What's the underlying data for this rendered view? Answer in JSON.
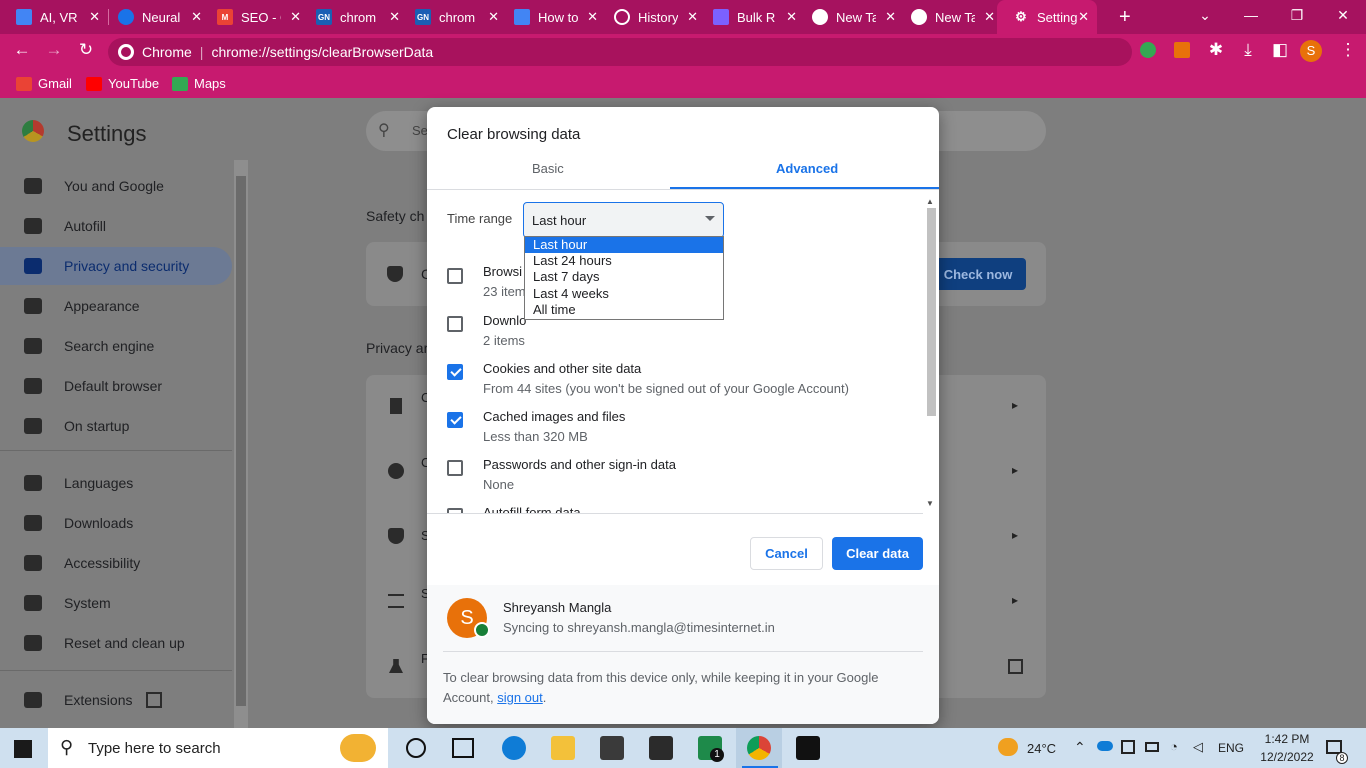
{
  "browser": {
    "tabs": [
      {
        "title": "AI, VR",
        "icon": "docs-icon",
        "color": "#4285f4"
      },
      {
        "title": "Neural",
        "icon": "neural-icon",
        "color": "#1a73e8"
      },
      {
        "title": "SEO - G",
        "icon": "gmail-icon",
        "color": "#ea4335"
      },
      {
        "title": "chrom",
        "icon": "gn-icon",
        "color": "#1a5fb4"
      },
      {
        "title": "chrom",
        "icon": "gn-icon",
        "color": "#1a5fb4"
      },
      {
        "title": "How to",
        "icon": "docs-icon",
        "color": "#4285f4"
      },
      {
        "title": "History",
        "icon": "history-icon",
        "color": "#5f6368"
      },
      {
        "title": "Bulk R",
        "icon": "bulk-icon",
        "color": "#7b61ff"
      },
      {
        "title": "New Ta",
        "icon": "chrome-icon",
        "color": "#5f6368"
      },
      {
        "title": "New Ta",
        "icon": "chrome-icon",
        "color": "#5f6368"
      },
      {
        "title": "Setting",
        "icon": "gear-icon",
        "color": "#5f6368"
      }
    ],
    "new_tab": "+",
    "address": {
      "site_label": "Chrome",
      "url": "chrome://settings/clearBrowserData"
    },
    "profile_initial": "S",
    "bookmarks": [
      {
        "label": "Gmail",
        "icon": "gmail-icon",
        "color": "#ea4335"
      },
      {
        "label": "YouTube",
        "icon": "youtube-icon",
        "color": "#ff0000"
      },
      {
        "label": "Maps",
        "icon": "maps-icon",
        "color": "#34a853"
      }
    ]
  },
  "settings": {
    "title": "Settings",
    "search_placeholder": "Se",
    "nav": [
      {
        "label": "You and Google",
        "icon": "person-icon"
      },
      {
        "label": "Autofill",
        "icon": "clipboard-icon"
      },
      {
        "label": "Privacy and security",
        "icon": "shield-icon"
      },
      {
        "label": "Appearance",
        "icon": "palette-icon"
      },
      {
        "label": "Search engine",
        "icon": "search-icon"
      },
      {
        "label": "Default browser",
        "icon": "browser-icon"
      },
      {
        "label": "On startup",
        "icon": "power-icon"
      },
      {
        "label": "Languages",
        "icon": "globe-icon"
      },
      {
        "label": "Downloads",
        "icon": "download-icon"
      },
      {
        "label": "Accessibility",
        "icon": "accessibility-icon"
      },
      {
        "label": "System",
        "icon": "wrench-icon"
      },
      {
        "label": "Reset and clean up",
        "icon": "restore-icon"
      },
      {
        "label": "Extensions",
        "icon": "puzzle-icon"
      }
    ],
    "safety_heading": "Safety ch",
    "privacy_heading": "Privacy ar",
    "check_now": "Check now",
    "row_initials": [
      "C",
      "C",
      "C",
      "S",
      "S",
      "F"
    ]
  },
  "dialog": {
    "title": "Clear browsing data",
    "tabs": {
      "basic": "Basic",
      "advanced": "Advanced"
    },
    "time_range_label": "Time range",
    "time_range_value": "Last hour",
    "time_range_options": [
      "Last hour",
      "Last 24 hours",
      "Last 7 days",
      "Last 4 weeks",
      "All time"
    ],
    "items": [
      {
        "label": "Browsi",
        "sub": "23 item",
        "checked": false
      },
      {
        "label": "Downlo",
        "sub": "2 items",
        "checked": false
      },
      {
        "label": "Cookies and other site data",
        "sub": "From 44 sites (you won't be signed out of your Google Account)",
        "checked": true
      },
      {
        "label": "Cached images and files",
        "sub": "Less than 320 MB",
        "checked": true
      },
      {
        "label": "Passwords and other sign-in data",
        "sub": "None",
        "checked": false
      },
      {
        "label": "Autofill form data",
        "sub": "",
        "checked": false
      }
    ],
    "cancel": "Cancel",
    "clear": "Clear data",
    "account": {
      "initial": "S",
      "name": "Shreyansh Mangla",
      "sync": "Syncing to shreyansh.mangla@timesinternet.in"
    },
    "footer_text": "To clear browsing data from this device only, while keeping it in your Google Account,",
    "footer_link": "sign out",
    "footer_end": "."
  },
  "taskbar": {
    "search_placeholder": "Type here to search",
    "weather": "24°C",
    "lang": "ENG",
    "time": "1:42 PM",
    "date": "12/2/2022",
    "notif_count": "8",
    "chat_badge": "1"
  },
  "colors": {
    "accent": "#1a73e8",
    "browser_frame": "#c71a6f"
  }
}
